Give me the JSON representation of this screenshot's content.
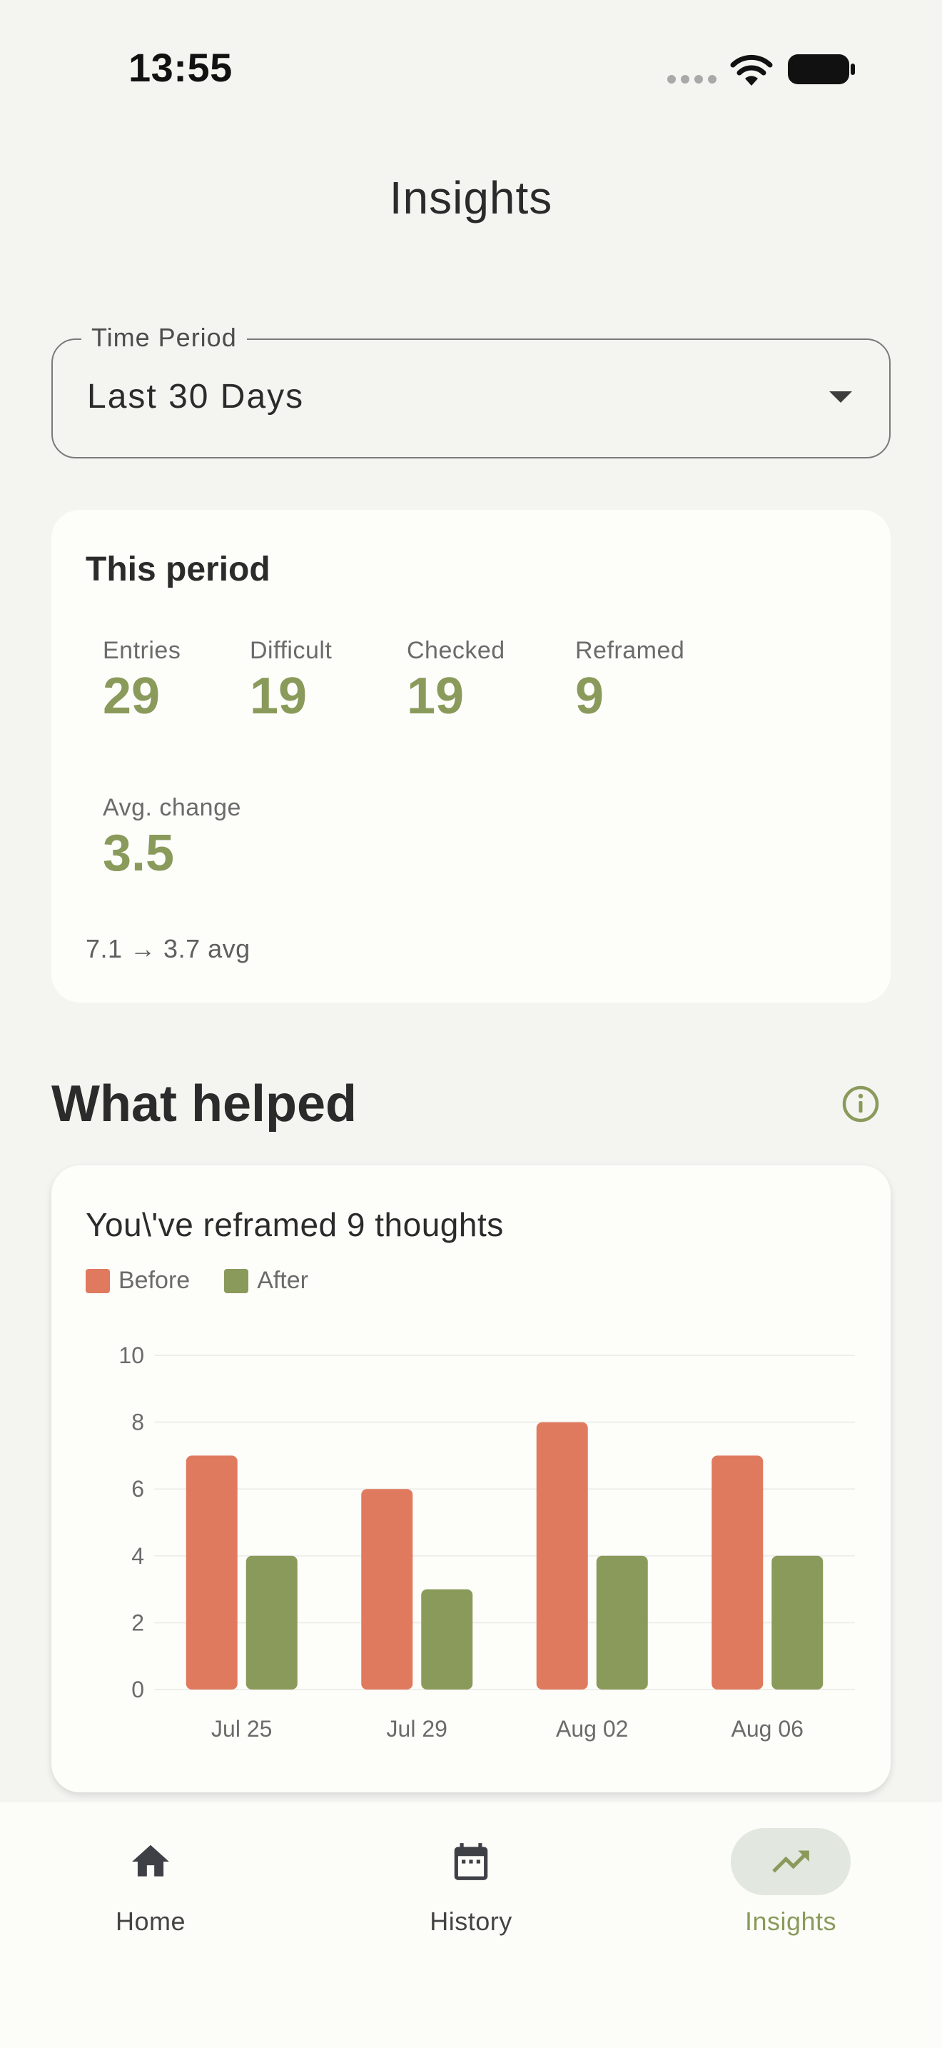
{
  "status_bar": {
    "time": "13:55"
  },
  "page_title": "Insights",
  "time_period": {
    "label": "Time Period",
    "value": "Last 30 Days"
  },
  "summary": {
    "heading": "This period",
    "stats": [
      {
        "label": "Entries",
        "value": "29"
      },
      {
        "label": "Difficult",
        "value": "19"
      },
      {
        "label": "Checked",
        "value": "19"
      },
      {
        "label": "Reframed",
        "value": "9"
      },
      {
        "label": "Avg. change",
        "value": "3.5"
      }
    ],
    "avg_note": "7.1 → 3.7 avg"
  },
  "section_title": "What helped",
  "chart": {
    "heading": "You\\'ve reframed 9 thoughts",
    "legend": [
      "Before",
      "After"
    ]
  },
  "colors": {
    "accent": "#8a9a5b",
    "before": "#e07a5f",
    "after": "#8a9a5b",
    "background": "#f4f4f1"
  },
  "chart_data": {
    "type": "bar",
    "categories": [
      "Jul 25",
      "Jul 29",
      "Aug 02",
      "Aug 06"
    ],
    "series": [
      {
        "name": "Before",
        "values": [
          7,
          6,
          8,
          7
        ]
      },
      {
        "name": "After",
        "values": [
          4,
          3,
          4,
          4
        ]
      }
    ],
    "ylim": [
      0,
      10
    ],
    "yticks": [
      0,
      2,
      4,
      6,
      8,
      10
    ],
    "grid": true,
    "legend": "top-left"
  },
  "nav": {
    "items": [
      {
        "label": "Home",
        "icon": "home-icon"
      },
      {
        "label": "History",
        "icon": "calendar-icon"
      },
      {
        "label": "Insights",
        "icon": "trending-up-icon"
      }
    ],
    "active": "Insights"
  }
}
